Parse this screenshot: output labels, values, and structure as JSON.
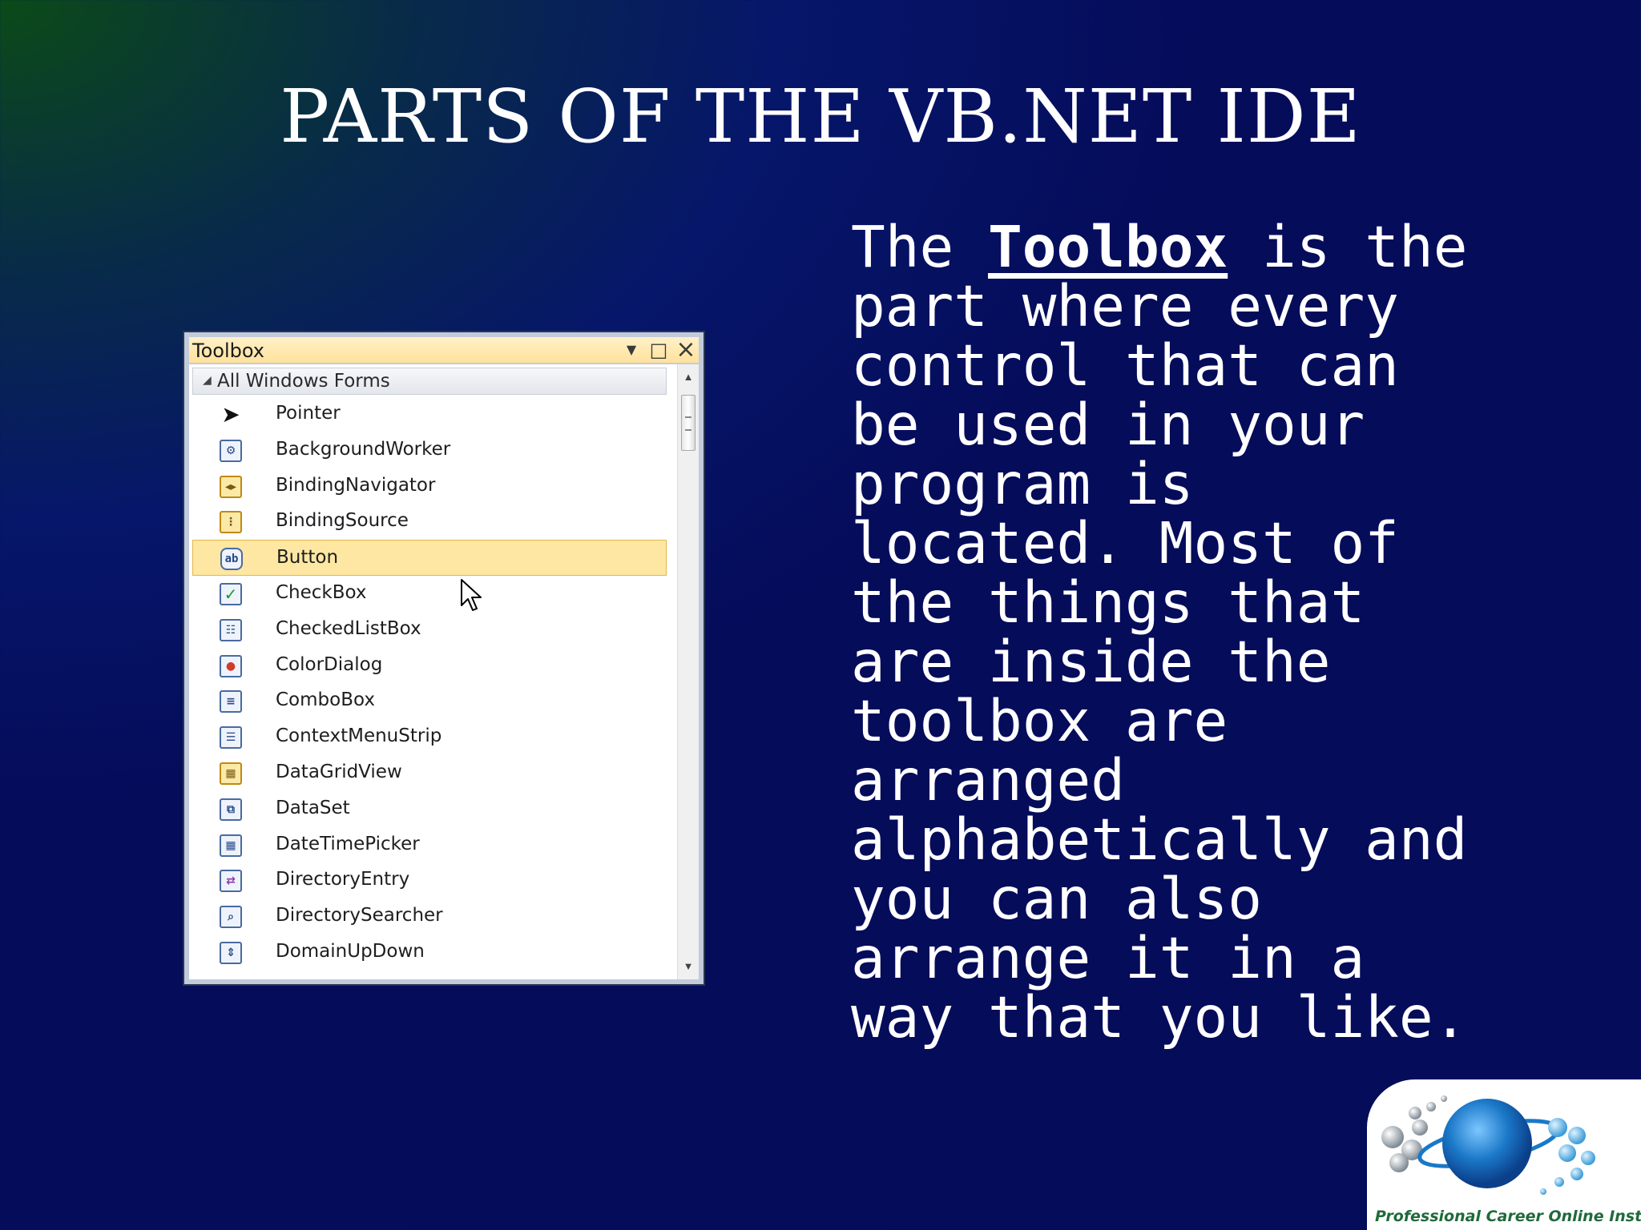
{
  "slide": {
    "title": "PARTS OF THE VB.NET IDE",
    "body_prefix": "The ",
    "body_keyword": "Toolbox",
    "body_suffix": " is the\npart where every\ncontrol that can\nbe used in your\nprogram is\nlocated. Most of\nthe things that\nare inside the\ntoolbox are\narranged\nalphabetically and\nyou can also\narrange it in a\nway that you like."
  },
  "toolbox": {
    "title": "Toolbox",
    "group_label": "All Windows Forms",
    "controls": {
      "dropdown": "▼",
      "maximize": "□",
      "close": "×"
    },
    "items": [
      {
        "label": "Pointer",
        "icon": "pointer-icon"
      },
      {
        "label": "BackgroundWorker",
        "icon": "background-worker-icon"
      },
      {
        "label": "BindingNavigator",
        "icon": "binding-navigator-icon"
      },
      {
        "label": "BindingSource",
        "icon": "binding-source-icon"
      },
      {
        "label": "Button",
        "icon": "button-icon",
        "selected": true
      },
      {
        "label": "CheckBox",
        "icon": "checkbox-icon"
      },
      {
        "label": "CheckedListBox",
        "icon": "checked-list-box-icon"
      },
      {
        "label": "ColorDialog",
        "icon": "color-dialog-icon"
      },
      {
        "label": "ComboBox",
        "icon": "combobox-icon"
      },
      {
        "label": "ContextMenuStrip",
        "icon": "context-menu-strip-icon"
      },
      {
        "label": "DataGridView",
        "icon": "data-grid-view-icon"
      },
      {
        "label": "DataSet",
        "icon": "dataset-icon"
      },
      {
        "label": "DateTimePicker",
        "icon": "date-time-picker-icon"
      },
      {
        "label": "DirectoryEntry",
        "icon": "directory-entry-icon"
      },
      {
        "label": "DirectorySearcher",
        "icon": "directory-searcher-icon"
      },
      {
        "label": "DomainUpDown",
        "icon": "domain-up-down-icon"
      }
    ]
  },
  "logo": {
    "text": "Professional Career Online Institute",
    "colors": {
      "globe": "#1b78c8",
      "spheres": "#9aa4ae",
      "text": "#1f6a3a"
    }
  }
}
